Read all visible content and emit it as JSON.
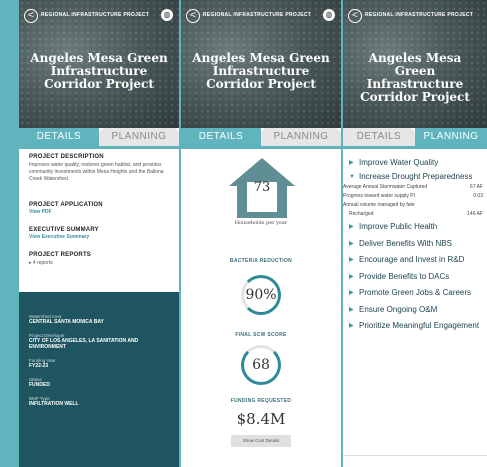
{
  "header": {
    "program_tag": "REGIONAL INFRASTRUCTURE PROJECT",
    "project_title": "Angeles Mesa Green Infrastructure Corridor Project",
    "back_glyph": "<",
    "badge_glyph": "◍"
  },
  "tabs": {
    "details": "DETAILS",
    "planning": "PLANNING"
  },
  "details_panel": {
    "description_heading": "PROJECT DESCRIPTION",
    "description_text": "Improves water quality, restores green habitat, and provides community investments within Mesa Heights and the Ballona Creek Watershed.",
    "application_heading": "PROJECT APPLICATION",
    "application_link": "View PDF",
    "summary_heading": "EXECUTIVE SUMMARY",
    "summary_link": "View Executive Summary",
    "reports_heading": "PROJECT REPORTS",
    "reports_count": "▸ 4 reports",
    "attributes": [
      {
        "label": "Watershed Area",
        "value": "CENTRAL SANTA MONICA BAY"
      },
      {
        "label": "Project Developer",
        "value": "CITY OF LOS ANGELES, LA SANITATION AND ENVIRONMENT"
      },
      {
        "label": "Funding Year",
        "value": "FY22-23"
      },
      {
        "label": "Status",
        "value": "FUNDED"
      },
      {
        "label": "BMP Type",
        "value": "INFILTRATION WELL"
      }
    ]
  },
  "stats_panel": {
    "households_value": "73",
    "households_label": "Households per year",
    "bacteria_heading": "BACTERIA REDUCTION",
    "bacteria_value": "90%",
    "scw_heading": "FINAL SCW SCORE",
    "scw_value": "68",
    "funding_heading": "FUNDING REQUESTED",
    "funding_value": "$8.4M",
    "cost_button": "Show Cost Details"
  },
  "planning_panel": {
    "goals": [
      {
        "label": "Improve Water Quality",
        "expanded": false
      },
      {
        "label": "Increase Drought Preparedness",
        "expanded": true
      },
      {
        "label": "Improve Public Health",
        "expanded": false
      },
      {
        "label": "Deliver Benefits With NBS",
        "expanded": false
      },
      {
        "label": "Encourage and Invest in R&D",
        "expanded": false
      },
      {
        "label": "Provide Benefits to DACs",
        "expanded": false
      },
      {
        "label": "Promote Green Jobs & Careers",
        "expanded": false
      },
      {
        "label": "Ensure Ongoing O&M",
        "expanded": false
      },
      {
        "label": "Prioritize Meaningful Engagement",
        "expanded": false
      }
    ],
    "metrics": [
      {
        "label": "Average Annual Stormwater Captured",
        "value": "67 AF"
      },
      {
        "label": "Progress toward water supply PI",
        "value": "0.03"
      },
      {
        "label": "Annual volume managed by fate",
        "value": ""
      },
      {
        "label": "Recharged",
        "value": "146 AF"
      }
    ]
  },
  "colors": {
    "accent": "#5fb4bd",
    "dark_band": "#1f5560",
    "ring": "#2d8a98"
  }
}
